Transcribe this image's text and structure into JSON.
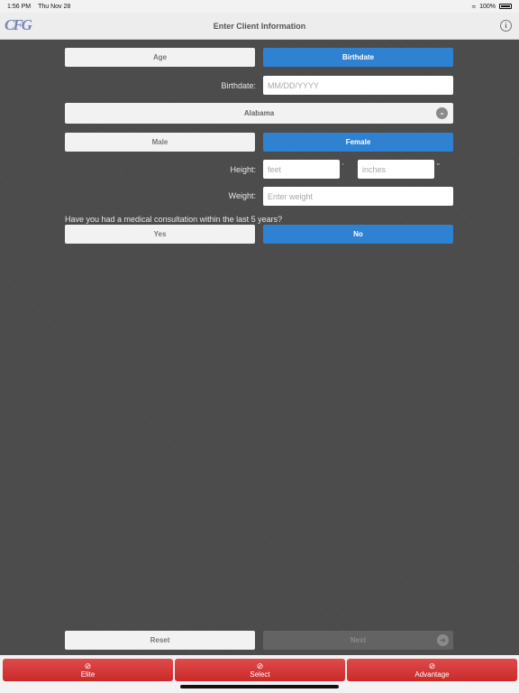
{
  "status_bar": {
    "time": "1:56 PM",
    "date": "Thu Nov 28",
    "battery": "100%"
  },
  "nav": {
    "title": "Enter Client Information",
    "logo_text": "CFG",
    "info_icon": "info-icon"
  },
  "mode_toggle": {
    "age_label": "Age",
    "birthdate_label": "Birthdate",
    "selected": "Birthdate"
  },
  "birthdate": {
    "label": "Birthdate:",
    "value": "",
    "placeholder": "MM/DD/YYYY"
  },
  "state_select": {
    "value": "Alabama"
  },
  "gender_toggle": {
    "male_label": "Male",
    "female_label": "Female",
    "selected": "Female"
  },
  "height": {
    "label": "Height:",
    "feet_placeholder": "feet",
    "feet_mark": "'",
    "inches_placeholder": "inches",
    "inches_mark": "\""
  },
  "weight": {
    "label": "Weight:",
    "placeholder": "Enter weight"
  },
  "medical": {
    "question": "Have you had a medical consultation within the last 5 years?",
    "yes_label": "Yes",
    "no_label": "No",
    "selected": "No"
  },
  "actions": {
    "reset_label": "Reset",
    "next_label": "Next"
  },
  "tabs": [
    {
      "label": "Elite",
      "icon": "no-entry-icon"
    },
    {
      "label": "Select",
      "icon": "no-entry-icon"
    },
    {
      "label": "Advantage",
      "icon": "no-entry-icon"
    }
  ],
  "colors": {
    "accent": "#2f82d2",
    "tab_red": "#d63a3a",
    "background": "#4a4a4a"
  }
}
